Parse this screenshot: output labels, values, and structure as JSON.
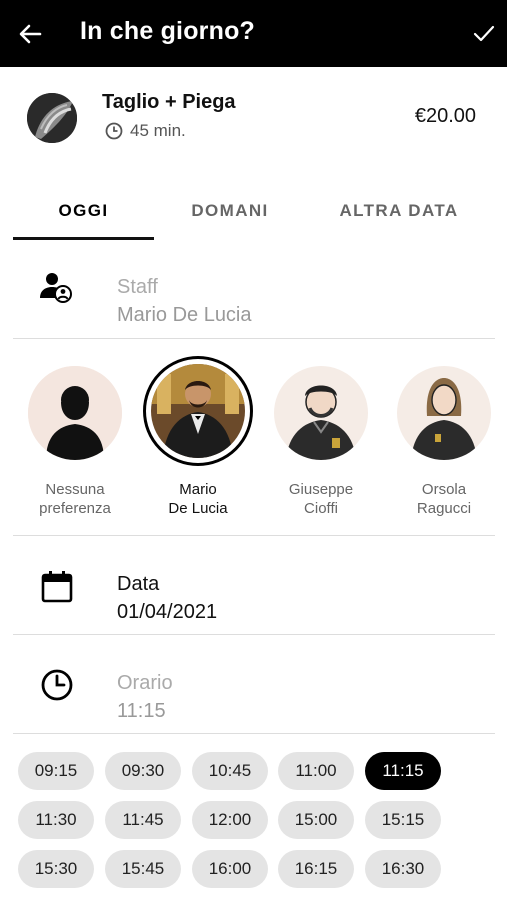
{
  "header": {
    "title": "In che giorno?",
    "back_icon": "arrow-left-icon",
    "confirm_icon": "check-icon"
  },
  "service": {
    "name": "Taglio + Piega",
    "duration": "45 min.",
    "price": "€20.00"
  },
  "tabs": [
    {
      "label": "OGGI",
      "active": true
    },
    {
      "label": "DOMANI",
      "active": false
    },
    {
      "label": "ALTRA DATA",
      "active": false
    }
  ],
  "staff_field": {
    "label": "Staff",
    "value": "Mario De Lucia"
  },
  "staff": [
    {
      "line1": "Nessuna",
      "line2": "preferenza",
      "selected": false
    },
    {
      "line1": "Mario",
      "line2": "De Lucia",
      "selected": true
    },
    {
      "line1": "Giuseppe",
      "line2": "Cioffi",
      "selected": false
    },
    {
      "line1": "Orsola",
      "line2": "Ragucci",
      "selected": false
    }
  ],
  "date_field": {
    "label": "Data",
    "value": "01/04/2021"
  },
  "time_field": {
    "label": "Orario",
    "value": "11:15"
  },
  "time_slots": [
    "09:15",
    "09:30",
    "10:45",
    "11:00",
    "11:15",
    "11:30",
    "11:45",
    "12:00",
    "15:00",
    "15:15",
    "15:30",
    "15:45",
    "16:00",
    "16:15",
    "16:30"
  ],
  "selected_slot": "11:15",
  "colors": {
    "primary": "#000000",
    "chip": "#e4e4e4",
    "muted": "#aaaaaa"
  }
}
